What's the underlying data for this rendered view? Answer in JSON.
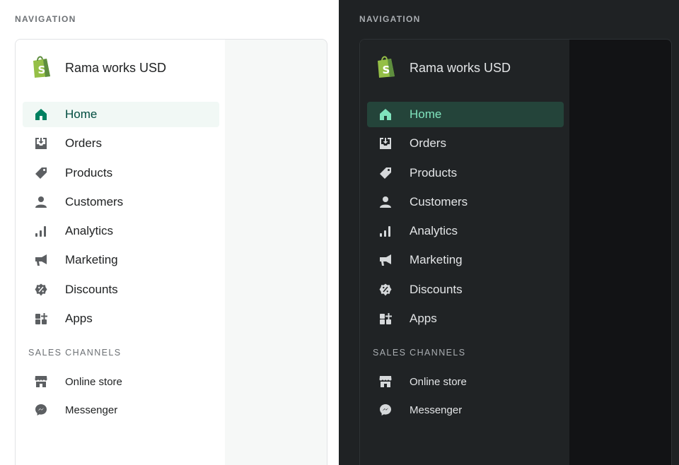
{
  "section_title": "NAVIGATION",
  "store": {
    "name": "Rama works USD",
    "logo_icon": "shopify-bag-icon"
  },
  "items": [
    {
      "label": "Home",
      "icon": "home-icon",
      "active": true
    },
    {
      "label": "Orders",
      "icon": "orders-inbox-icon"
    },
    {
      "label": "Products",
      "icon": "tag-icon"
    },
    {
      "label": "Customers",
      "icon": "person-icon"
    },
    {
      "label": "Analytics",
      "icon": "bar-chart-icon"
    },
    {
      "label": "Marketing",
      "icon": "megaphone-icon"
    },
    {
      "label": "Discounts",
      "icon": "discount-badge-icon"
    },
    {
      "label": "Apps",
      "icon": "apps-grid-icon"
    }
  ],
  "channels_title": "SALES CHANNELS",
  "channels": [
    {
      "label": "Online store",
      "icon": "storefront-icon"
    },
    {
      "label": "Messenger",
      "icon": "messenger-icon"
    }
  ],
  "colors": {
    "light_active_bg": "#f1f8f5",
    "light_active_text": "#004c3f",
    "light_active_icon": "#008060",
    "dark_bg": "#1f2224",
    "dark_active_bg": "#24443a",
    "dark_active_text": "#80e3bd",
    "shopify_green": "#95bf47"
  }
}
